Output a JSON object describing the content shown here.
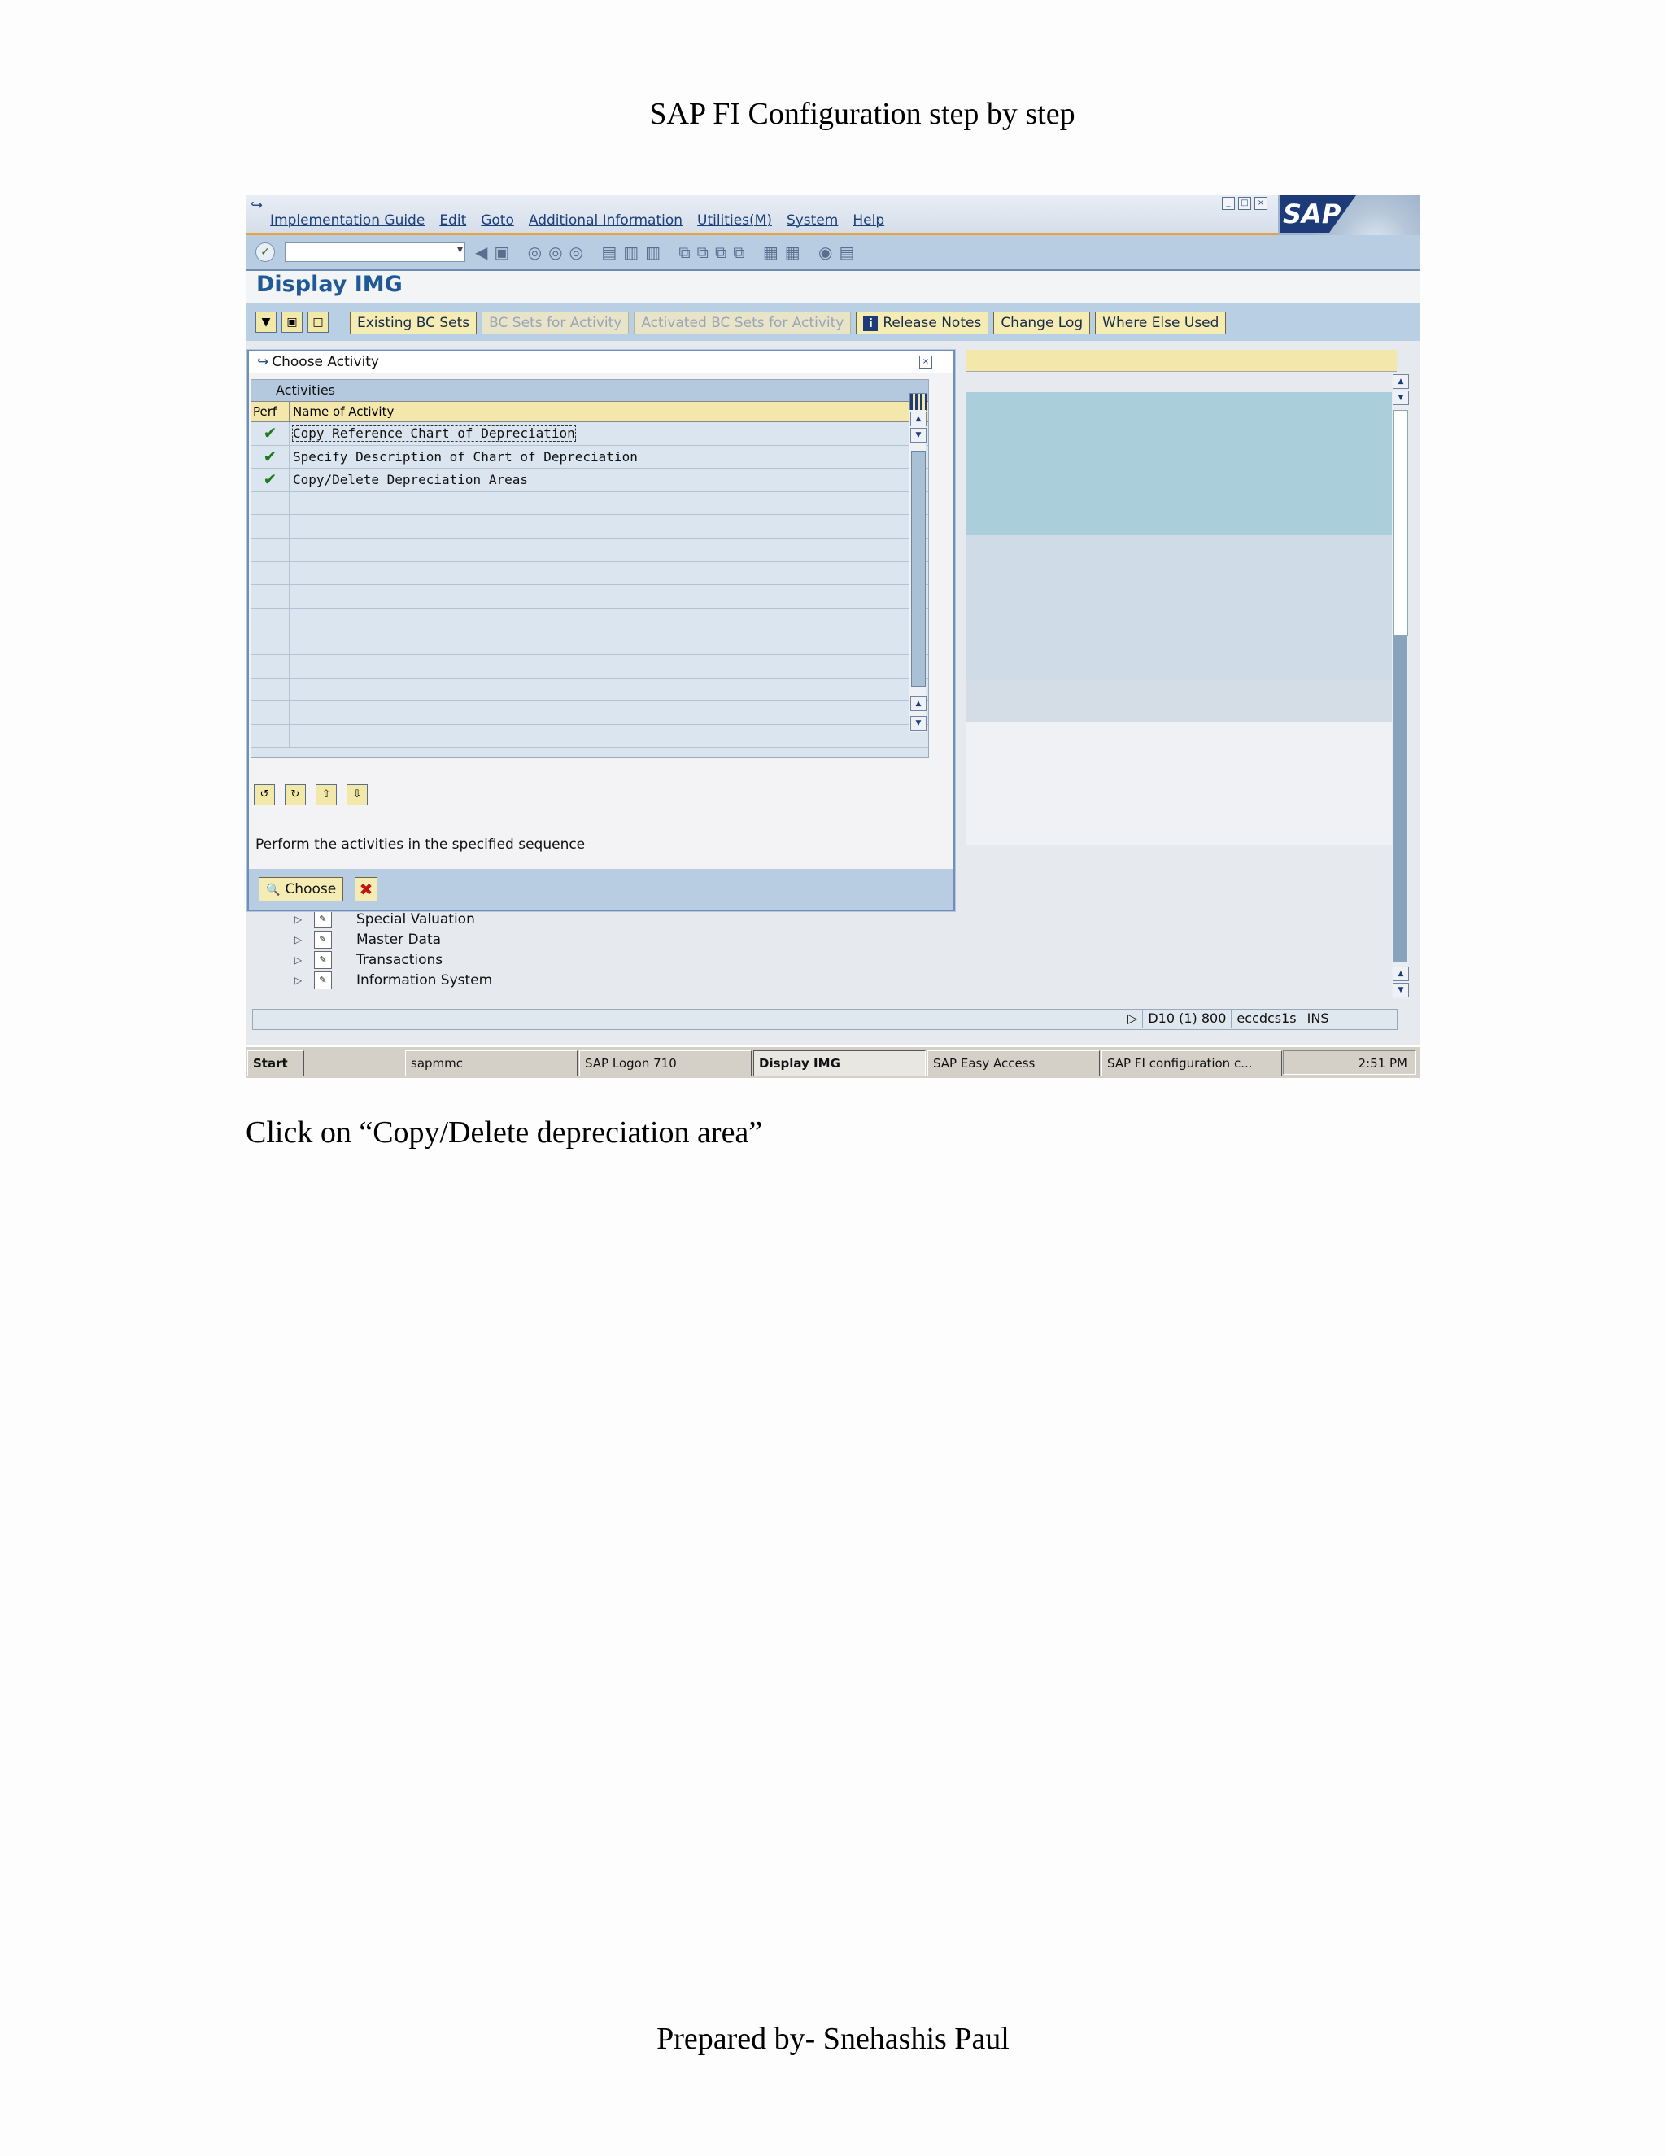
{
  "document": {
    "header": "SAP FI Configuration step by step",
    "caption": "Click on “Copy/Delete depreciation area”",
    "footer": "Prepared by- Snehashis Paul"
  },
  "menu": [
    "Implementation Guide",
    "Edit",
    "Goto",
    "Additional Information",
    "Utilities(M)",
    "System",
    "Help"
  ],
  "sap_logo": "SAP",
  "page_title": "Display IMG",
  "app_toolbar": {
    "existing_bc_sets": "Existing BC Sets",
    "bc_sets_for_activity": "BC Sets for Activity",
    "activated_bc_sets": "Activated BC Sets for Activity",
    "release_notes": "Release Notes",
    "change_log": "Change Log",
    "where_else_used": "Where Else Used"
  },
  "dialog": {
    "title": "Choose Activity",
    "table_caption": "Activities",
    "col_perf": "Perf",
    "col_name": "Name of Activity",
    "rows": [
      {
        "perf": "✔",
        "name": "Copy Reference Chart of Depreciation"
      },
      {
        "perf": "✔",
        "name": "Specify Description of Chart of Depreciation"
      },
      {
        "perf": "✔",
        "name": "Copy/Delete Depreciation Areas"
      }
    ],
    "hint": "Perform the activities in the specified sequence",
    "choose": "Choose",
    "cancel": "✖"
  },
  "tree": [
    "Special Valuation",
    "Master Data",
    "Transactions",
    "Information System"
  ],
  "status": {
    "system": "D10 (1) 800",
    "server": "eccdcs1s",
    "mode": "INS"
  },
  "taskbar": {
    "start": "Start",
    "items": [
      "sapmmc",
      "SAP Logon 710",
      "Display IMG",
      "SAP Easy Access",
      "SAP FI configuration c..."
    ],
    "clock": "2:51 PM"
  }
}
